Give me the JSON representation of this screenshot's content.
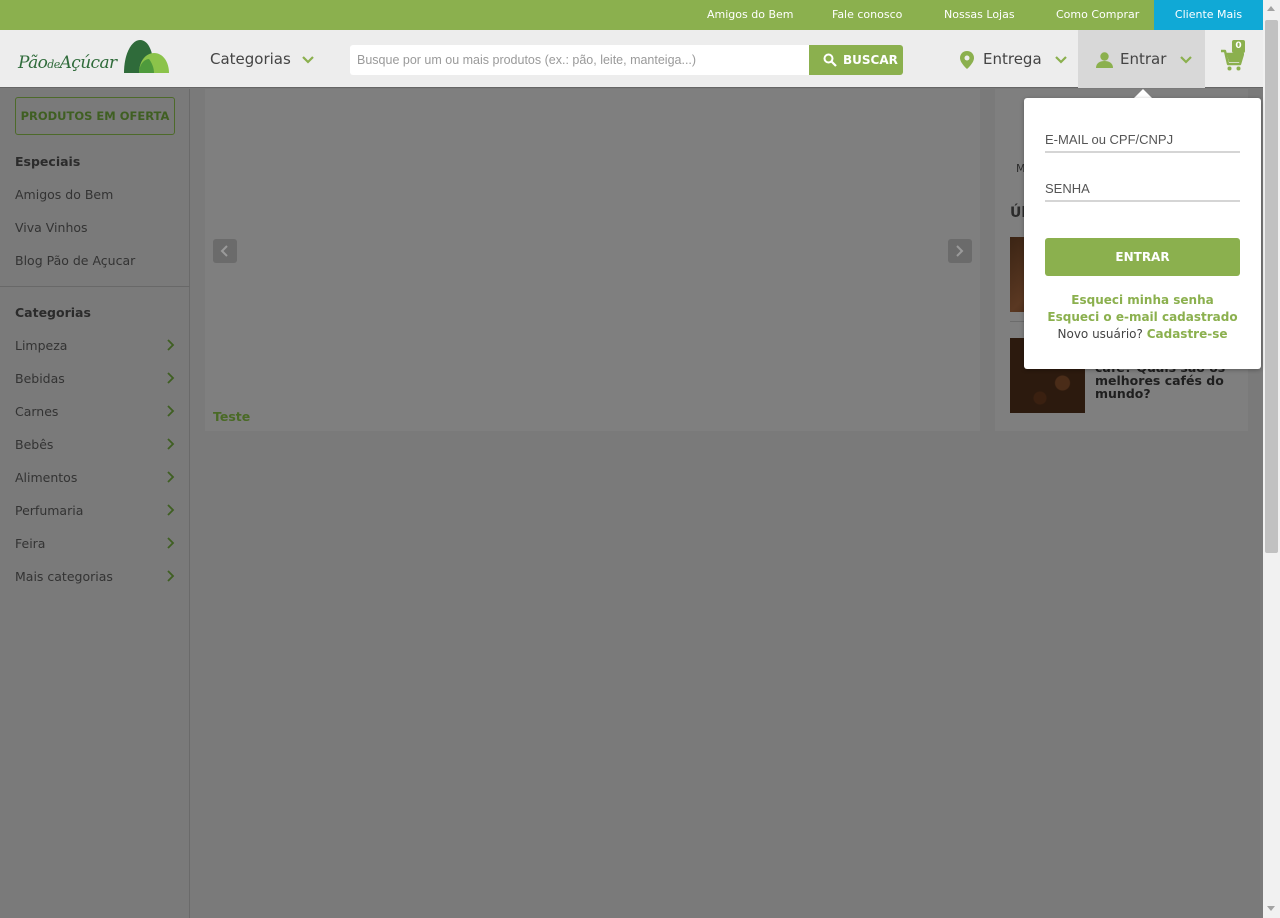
{
  "topbar": {
    "links": [
      "Amigos do Bem",
      "Fale conosco",
      "Nossas Lojas",
      "Como Comprar"
    ],
    "cliente_mais": "Cliente Mais"
  },
  "header": {
    "logo_text_1": "Pão",
    "logo_text_2": "de",
    "logo_text_3": "Açúcar",
    "categorias": "Categorias",
    "search_placeholder": "Busque por um ou mais produtos (ex.: pão, leite, manteiga...)",
    "buscar": "BUSCAR",
    "entrega": "Entrega",
    "entrar": "Entrar",
    "cart_count": "0"
  },
  "sidebar": {
    "oferta_button": "PRODUTOS EM OFERTA",
    "especiais_heading": "Especiais",
    "especiais": [
      "Amigos do Bem",
      "Viva Vinhos",
      "Blog Pão de Açucar"
    ],
    "categorias_heading": "Categorias",
    "categorias": [
      "Limpeza",
      "Bebidas",
      "Carnes",
      "Bebês",
      "Alimentos",
      "Perfumaria",
      "Feira",
      "Mais categorias"
    ]
  },
  "carousel": {
    "caption": "Teste"
  },
  "blog": {
    "partial_label": "M",
    "partial_heading": "Úl",
    "post2_title": "café? Quais são os melhores cafés do mundo?"
  },
  "login": {
    "email_placeholder": "E-MAIL ou CPF/CNPJ",
    "password_placeholder": "SENHA",
    "submit": "ENTRAR",
    "forgot_password": "Esqueci minha senha",
    "forgot_email": "Esqueci o e-mail cadastrado",
    "new_user": "Novo usuário?",
    "signup": "Cadastre-se"
  },
  "colors": {
    "brand_green": "#8bb04e",
    "cliente_mais_blue": "#10a9d6",
    "overlay_gray": "#7a7a7a"
  }
}
